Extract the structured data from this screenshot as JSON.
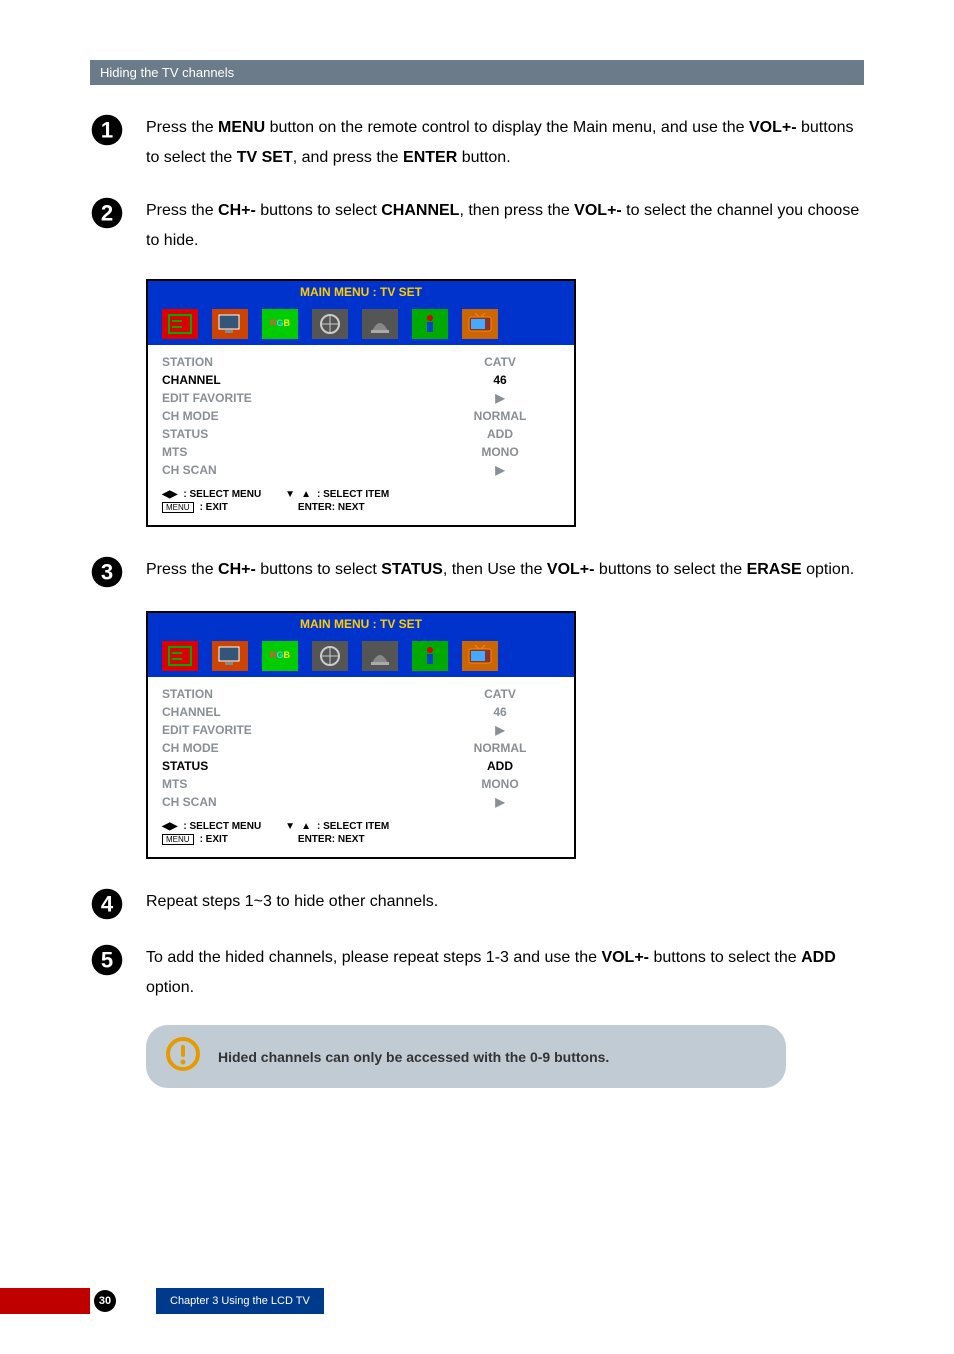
{
  "section_title": "Hiding the TV channels",
  "steps": {
    "s1": {
      "pre1": "Press the ",
      "b1": "MENU",
      "mid1": " button on the remote control to display the Main menu, and use the ",
      "b2": "VOL+-",
      "mid2": " buttons to select the ",
      "b3": "TV SET",
      "mid3": ", and press the ",
      "b4": "ENTER",
      "post": " button."
    },
    "s2": {
      "pre1": "Press the ",
      "b1": "CH+-",
      "mid1": " buttons to select ",
      "b2": "CHANNEL",
      "mid2": ", then press the ",
      "b3": "VOL+-",
      "post": " to select the channel you choose to hide."
    },
    "s3": {
      "pre1": "Press the ",
      "b1": "CH+-",
      "mid1": " buttons to select ",
      "b2": "STATUS",
      "mid2": ", then Use the ",
      "b3": "VOL+-",
      "mid3": " buttons to select the ",
      "b4": "ERASE",
      "post": " option."
    },
    "s4": {
      "text": "Repeat steps 1~3 to hide other channels."
    },
    "s5": {
      "pre1": "To add the hided channels, please repeat steps 1-3 and use the ",
      "b1": "VOL+-",
      "mid1": " buttons to select the ",
      "b2": "ADD",
      "post": " option."
    }
  },
  "osd": {
    "header": "MAIN MENU : TV SET",
    "rows": [
      {
        "label": "STATION",
        "value": "CATV"
      },
      {
        "label": "CHANNEL",
        "value": "46"
      },
      {
        "label": "EDIT FAVORITE",
        "value": "▶"
      },
      {
        "label": "CH MODE",
        "value": "NORMAL"
      },
      {
        "label": "STATUS",
        "value": "ADD"
      },
      {
        "label": "MTS",
        "value": "MONO"
      },
      {
        "label": "CH SCAN",
        "value": "▶"
      }
    ],
    "footer": {
      "select_menu": ": SELECT MENU",
      "select_item": ": SELECT ITEM",
      "exit": " : EXIT",
      "enter": "ENTER: NEXT",
      "menu_label": "MENU"
    }
  },
  "info_note": "Hided channels can only be accessed with the 0-9 buttons.",
  "footer": {
    "page_num": "30",
    "chapter": "Chapter 3 Using the LCD TV"
  }
}
